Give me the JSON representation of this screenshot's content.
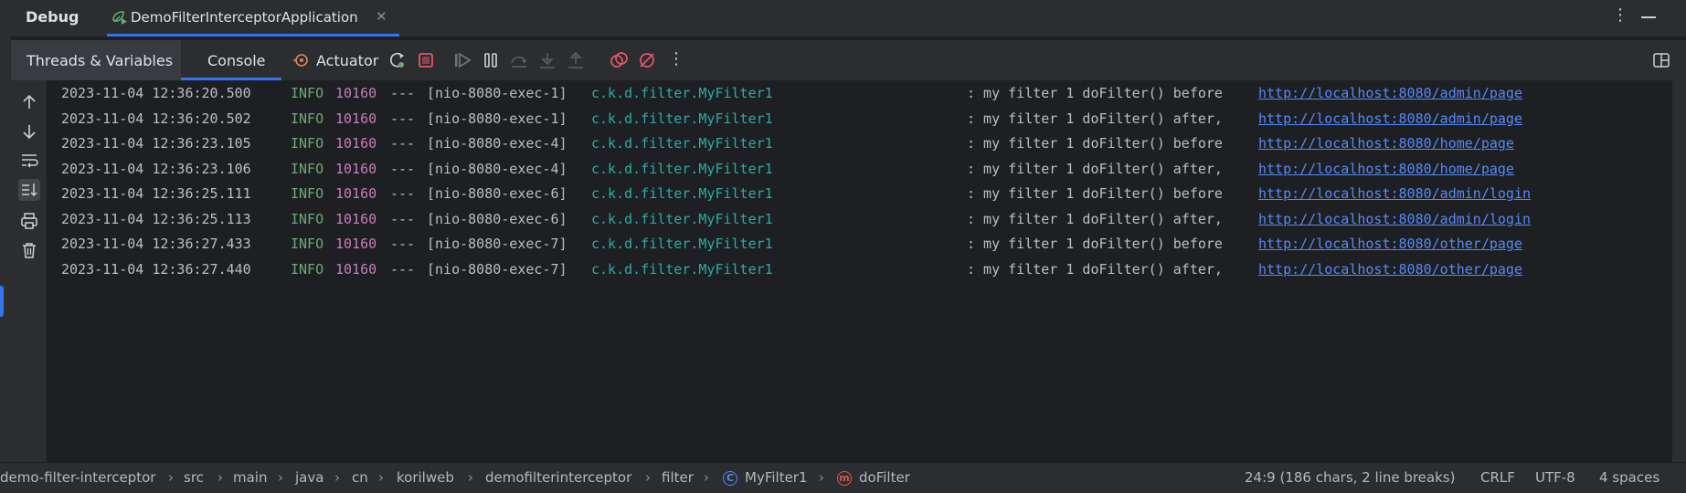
{
  "titlebar": {
    "section": "Debug",
    "run_tab": "DemoFilterInterceptorApplication",
    "run_icon": "spring-run-icon",
    "close_icon": "close-icon",
    "more_icon": "more-vertical-icon",
    "minimize_icon": "minimize-icon"
  },
  "toolbar": {
    "tabs": [
      {
        "label": "Threads & Variables"
      },
      {
        "label": "Console"
      },
      {
        "label": "Actuator"
      }
    ],
    "buttons": [
      "rerun-icon",
      "stop-icon",
      "resume-icon",
      "pause-icon",
      "step-over-icon",
      "step-into-icon",
      "step-out-icon",
      "view-breakpoints-icon",
      "mute-breakpoints-icon",
      "more-vertical-icon",
      "layout-icon"
    ]
  },
  "gutter": {
    "buttons": [
      "up-arrow-icon",
      "down-arrow-icon",
      "soft-wrap-icon",
      "scroll-to-end-icon",
      "print-icon",
      "clear-all-icon"
    ]
  },
  "console": {
    "lines": [
      {
        "ts": "2023-11-04 12:36:20.500",
        "level": "INFO",
        "pid": "10160",
        "sep": "---",
        "thread": "[nio-8080-exec-1]",
        "cls": "c.k.d.filter.MyFilter1",
        "msg": ": my filter 1 doFilter() before",
        "url": "http://localhost:8080/admin/page"
      },
      {
        "ts": "2023-11-04 12:36:20.502",
        "level": "INFO",
        "pid": "10160",
        "sep": "---",
        "thread": "[nio-8080-exec-1]",
        "cls": "c.k.d.filter.MyFilter1",
        "msg": ": my filter 1 doFilter() after,",
        "url": "http://localhost:8080/admin/page"
      },
      {
        "ts": "2023-11-04 12:36:23.105",
        "level": "INFO",
        "pid": "10160",
        "sep": "---",
        "thread": "[nio-8080-exec-4]",
        "cls": "c.k.d.filter.MyFilter1",
        "msg": ": my filter 1 doFilter() before",
        "url": "http://localhost:8080/home/page"
      },
      {
        "ts": "2023-11-04 12:36:23.106",
        "level": "INFO",
        "pid": "10160",
        "sep": "---",
        "thread": "[nio-8080-exec-4]",
        "cls": "c.k.d.filter.MyFilter1",
        "msg": ": my filter 1 doFilter() after,",
        "url": "http://localhost:8080/home/page"
      },
      {
        "ts": "2023-11-04 12:36:25.111",
        "level": "INFO",
        "pid": "10160",
        "sep": "---",
        "thread": "[nio-8080-exec-6]",
        "cls": "c.k.d.filter.MyFilter1",
        "msg": ": my filter 1 doFilter() before",
        "url": "http://localhost:8080/admin/login"
      },
      {
        "ts": "2023-11-04 12:36:25.113",
        "level": "INFO",
        "pid": "10160",
        "sep": "---",
        "thread": "[nio-8080-exec-6]",
        "cls": "c.k.d.filter.MyFilter1",
        "msg": ": my filter 1 doFilter() after,",
        "url": "http://localhost:8080/admin/login"
      },
      {
        "ts": "2023-11-04 12:36:27.433",
        "level": "INFO",
        "pid": "10160",
        "sep": "---",
        "thread": "[nio-8080-exec-7]",
        "cls": "c.k.d.filter.MyFilter1",
        "msg": ": my filter 1 doFilter() before",
        "url": "http://localhost:8080/other/page"
      },
      {
        "ts": "2023-11-04 12:36:27.440",
        "level": "INFO",
        "pid": "10160",
        "sep": "---",
        "thread": "[nio-8080-exec-7]",
        "cls": "c.k.d.filter.MyFilter1",
        "msg": ": my filter 1 doFilter() after,",
        "url": "http://localhost:8080/other/page"
      }
    ]
  },
  "statusbar": {
    "breadcrumbs": [
      "demo-filter-interceptor",
      "src",
      "main",
      "java",
      "cn",
      "korilweb",
      "demofilterinterceptor",
      "filter",
      "MyFilter1",
      "doFilter"
    ],
    "class_icon_letter": "C",
    "method_icon_letter": "m",
    "position": "24:9 (186 chars, 2 line breaks)",
    "line_separator": "CRLF",
    "encoding": "UTF-8",
    "indent": "4 spaces"
  },
  "colors": {
    "accent": "#3574f0",
    "info": "#6aab73",
    "pid": "#c77dbb",
    "class": "#2aaca4",
    "link": "#548af7"
  }
}
